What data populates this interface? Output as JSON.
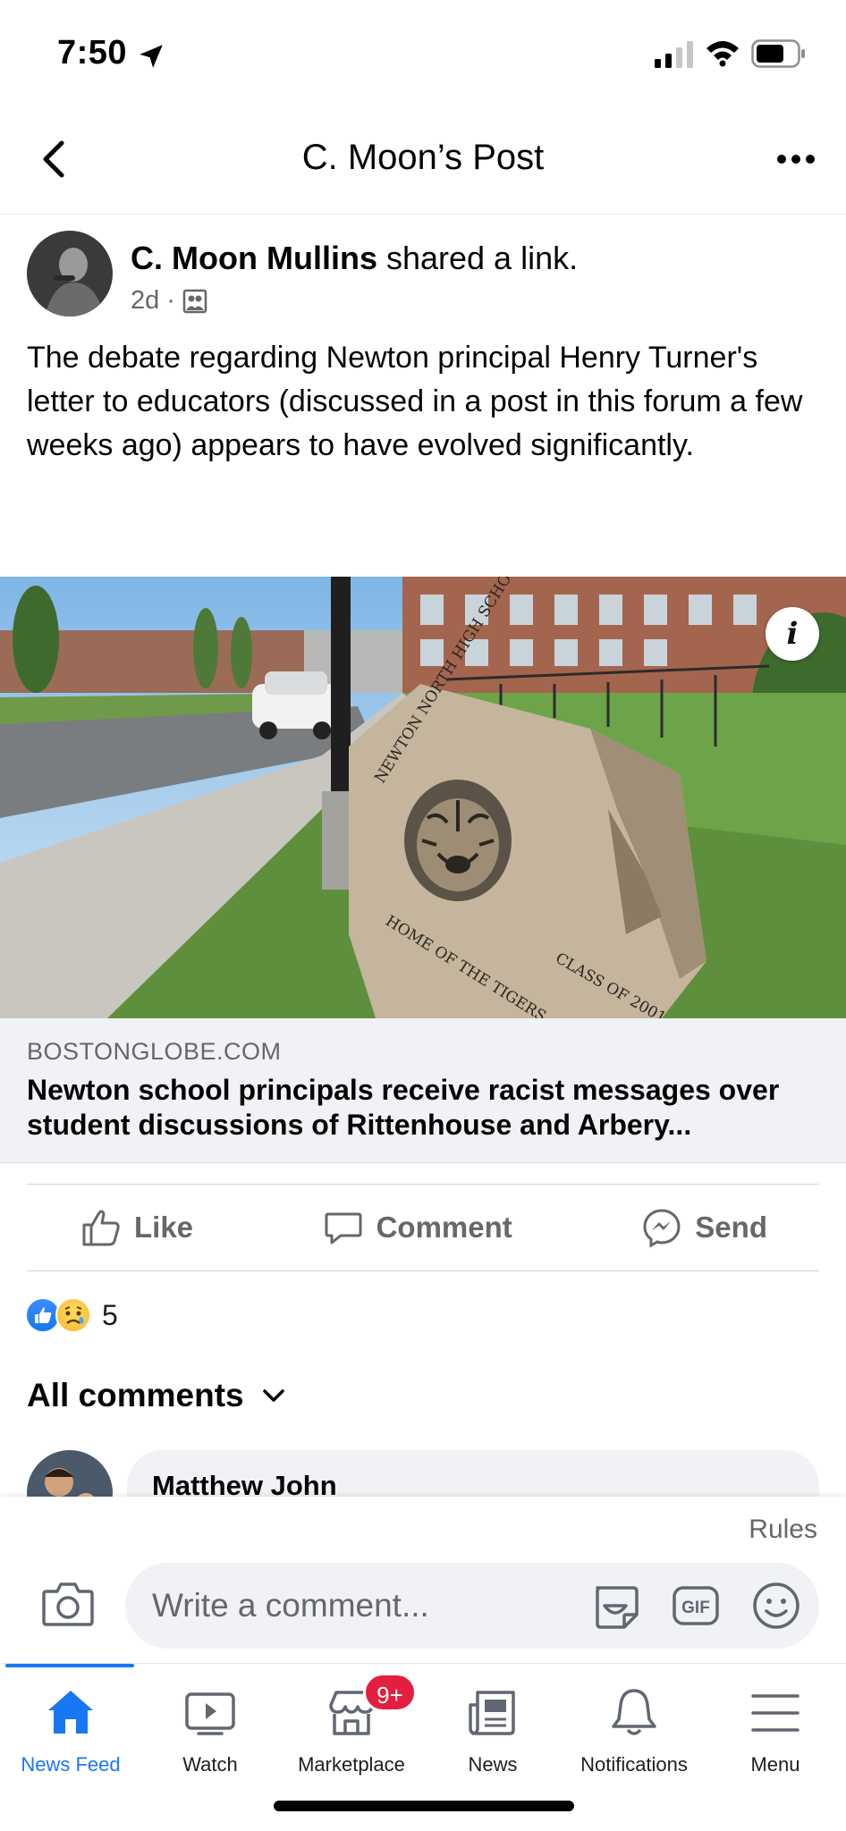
{
  "status_bar": {
    "time": "7:50"
  },
  "header": {
    "title": "C. Moon’s Post"
  },
  "post": {
    "author": "C. Moon Mullins",
    "action": " shared a link.",
    "time": "2d",
    "separator": "·",
    "text": "The debate regarding Newton principal Henry Turner's letter to educators (discussed in a post in this forum a few weeks ago) appears to have evolved significantly."
  },
  "link": {
    "domain": "BOSTONGLOBE.COM",
    "title": "Newton school principals receive racist messages over student discussions of Rittenhouse and Arbery...",
    "info_label": "i",
    "image_text": {
      "rock_arc": "NEWTON NORTH HIGH SCHOOL",
      "rock_bottom": "HOME OF THE TIGERS",
      "rock_class": "CLASS OF 2001"
    }
  },
  "actions": {
    "like": "Like",
    "comment": "Comment",
    "send": "Send"
  },
  "reactions": {
    "count": "5"
  },
  "comments": {
    "header": "All comments",
    "first_author": "Matthew John"
  },
  "composer": {
    "rules": "Rules",
    "placeholder": "Write a comment...",
    "gif_label": "GIF"
  },
  "tabs": [
    {
      "label": "News Feed",
      "icon": "home-icon"
    },
    {
      "label": "Watch",
      "icon": "watch-icon"
    },
    {
      "label": "Marketplace",
      "icon": "marketplace-icon",
      "badge": "9+"
    },
    {
      "label": "News",
      "icon": "news-icon"
    },
    {
      "label": "Notifications",
      "icon": "bell-icon"
    },
    {
      "label": "Menu",
      "icon": "menu-icon"
    }
  ],
  "colors": {
    "accent": "#1877f2",
    "badge": "#e41e3f",
    "secondary_text": "#65676b"
  }
}
